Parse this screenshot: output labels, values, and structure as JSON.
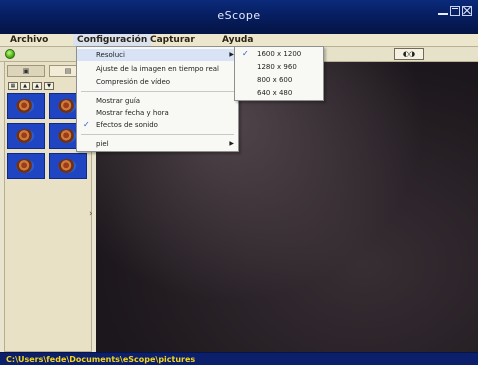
{
  "window": {
    "title": "eScope"
  },
  "menubar": {
    "items": [
      "Archivo",
      "Configuración",
      "Capturar",
      "Ayuda"
    ]
  },
  "configuracion_menu": {
    "items": [
      {
        "label": "Resoluci",
        "checked": false,
        "has_submenu": true,
        "highlighted": true
      },
      {
        "label": "Ajuste de la imagen en tiempo real",
        "checked": false,
        "has_submenu": false
      },
      {
        "label": "Compresión de vídeo",
        "checked": false,
        "has_submenu": false
      },
      {
        "label": "Mostrar guía",
        "checked": false,
        "has_submenu": false
      },
      {
        "label": "Mostrar fecha y hora",
        "checked": false,
        "has_submenu": false
      },
      {
        "label": "Efectos de sonido",
        "checked": true,
        "has_submenu": false
      },
      {
        "label": "piel",
        "checked": false,
        "has_submenu": true
      }
    ]
  },
  "resolution_submenu": {
    "items": [
      {
        "label": "1600 x 1200",
        "checked": true
      },
      {
        "label": "1280 x 960",
        "checked": false
      },
      {
        "label": "800 x 600",
        "checked": false
      },
      {
        "label": "640 x 480",
        "checked": false
      }
    ]
  },
  "status": {
    "path": "C:\\Users\\fede\\Documents\\eScope\\pictures"
  },
  "colors": {
    "titlebar": "#061c5c",
    "statusbar": "#0b1f6b",
    "status_text": "#f4d51c",
    "thumbnail_border": "#1f45c2"
  },
  "icons": [
    "green-record-icon",
    "camera-icon",
    "snapshot-icon",
    "checkmark-icon",
    "submenu-arrow-icon",
    "minimize-icon",
    "maximize-icon",
    "close-icon"
  ]
}
